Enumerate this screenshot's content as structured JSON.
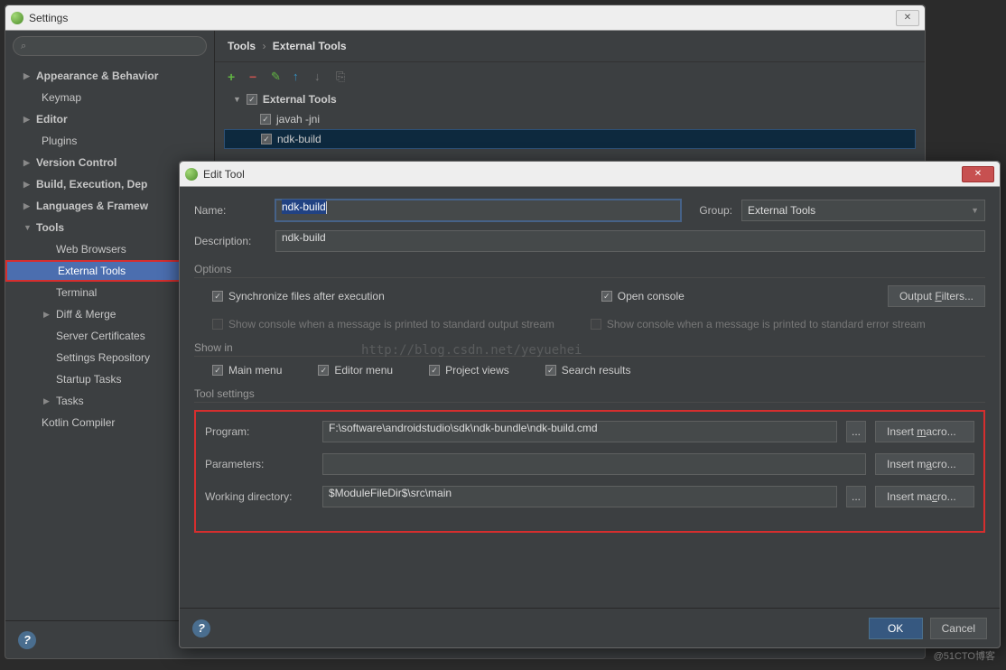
{
  "settings": {
    "title": "Settings",
    "search_placeholder": "",
    "tree": {
      "appearance": "Appearance & Behavior",
      "keymap": "Keymap",
      "editor": "Editor",
      "plugins": "Plugins",
      "vcs": "Version Control",
      "build": "Build, Execution, Dep",
      "lang": "Languages & Framew",
      "tools": "Tools",
      "tools_children": {
        "web": "Web Browsers",
        "external": "External Tools",
        "terminal": "Terminal",
        "diff": "Diff & Merge",
        "server": "Server Certificates",
        "repo": "Settings Repository",
        "startup": "Startup Tasks",
        "tasks": "Tasks"
      },
      "kotlin": "Kotlin Compiler"
    },
    "breadcrumb": {
      "root": "Tools",
      "leaf": "External Tools"
    },
    "tool_tree": {
      "group": "External Tools",
      "items": [
        "javah -jni",
        "ndk-build"
      ]
    }
  },
  "dialog": {
    "title": "Edit Tool",
    "name_lbl": "Name:",
    "name_val": "ndk-build",
    "desc_lbl": "Description:",
    "desc_val": "ndk-build",
    "group_lbl": "Group:",
    "group_val": "External Tools",
    "options_title": "Options",
    "sync": "Synchronize files after execution",
    "open_console": "Open console",
    "output_filters": "Output Filters...",
    "show_stdout": "Show console when a message is printed to standard output stream",
    "show_stderr": "Show console when a message is printed to standard error stream",
    "showin_title": "Show in",
    "main_menu": "Main menu",
    "editor_menu": "Editor menu",
    "project_views": "Project views",
    "search_results": "Search results",
    "toolset_title": "Tool settings",
    "program_lbl": "Program:",
    "program_val": "F:\\software\\androidstudio\\sdk\\ndk-bundle\\ndk-build.cmd",
    "params_lbl": "Parameters:",
    "params_val": "",
    "workdir_lbl": "Working directory:",
    "workdir_val": "$ModuleFileDir$\\src\\main",
    "browse": "...",
    "insert_macro": "Insert macro...",
    "ok": "OK",
    "cancel": "Cancel"
  },
  "watermark": "http://blog.csdn.net/yeyuehei",
  "watermark2": "@51CTO博客"
}
